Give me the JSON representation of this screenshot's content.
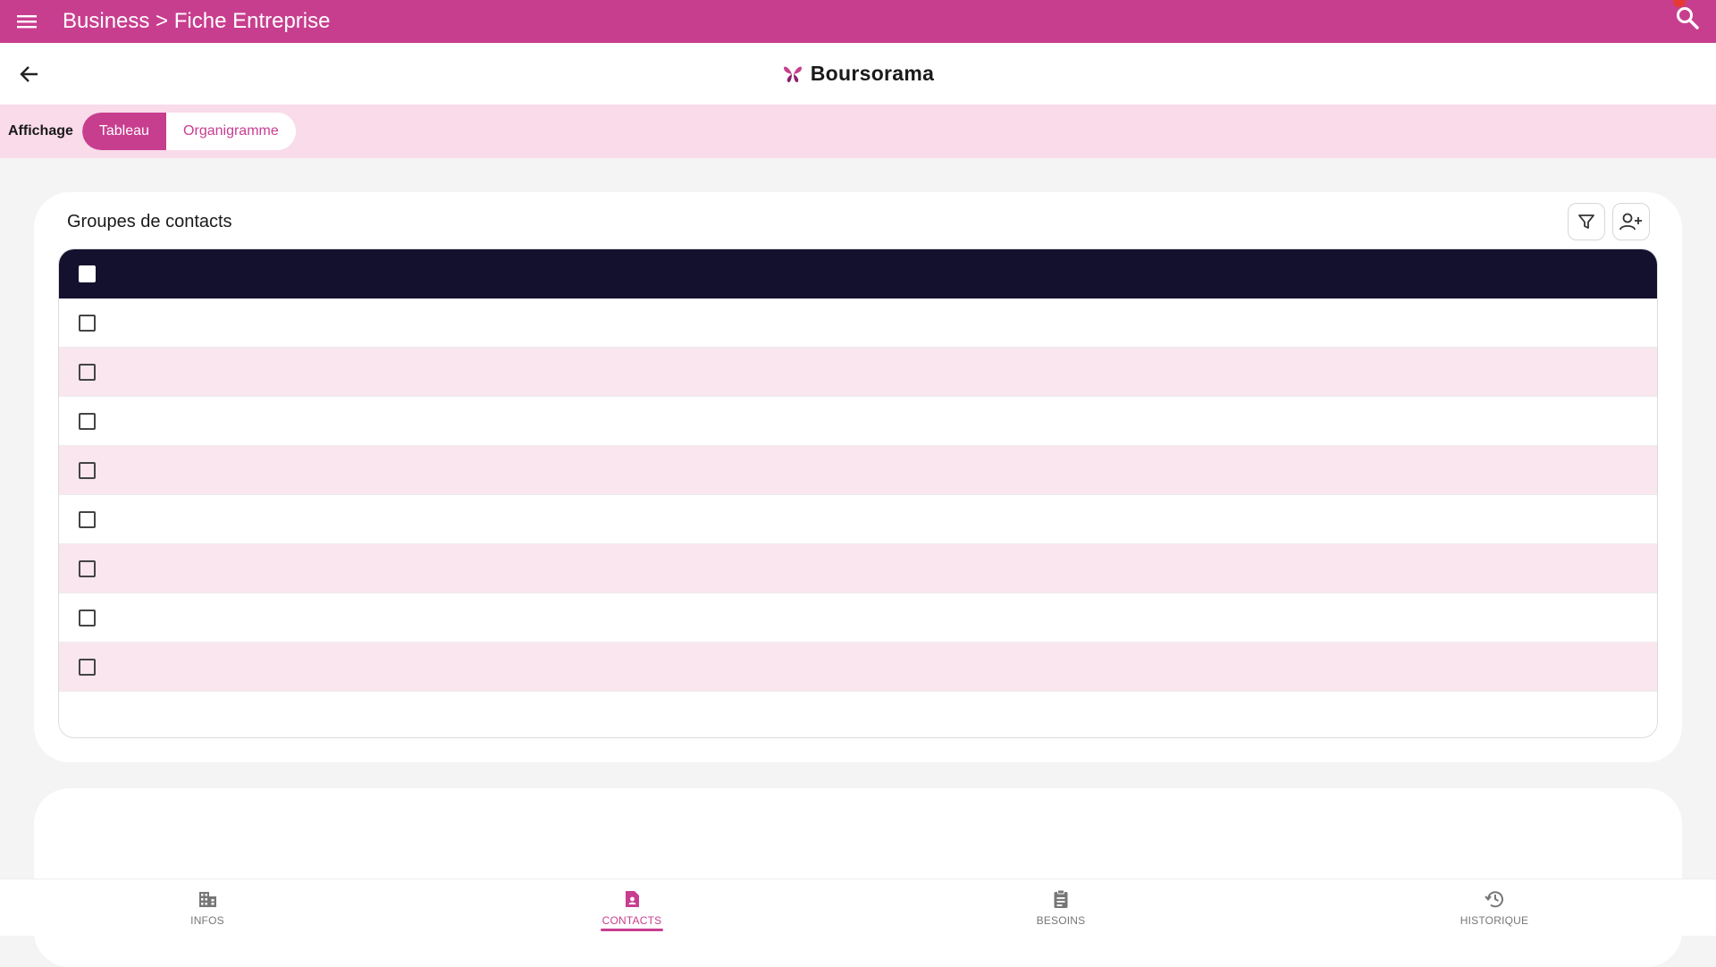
{
  "topbar": {
    "title": "Business > Fiche Entreprise",
    "color": "#c83e8f",
    "menu_icon": "menu-icon",
    "search_icon": "search-icon"
  },
  "header": {
    "company_name": "Boursorama",
    "back_icon": "arrow-left-icon",
    "logo_icon": "butterfly-logo"
  },
  "display": {
    "label": "Affichage",
    "options": [
      "Tableau",
      "Organigramme"
    ],
    "selected": "Tableau"
  },
  "contacts_card": {
    "title": "Groupes de contacts",
    "filter_icon": "filter-icon",
    "add_contact_icon": "add-contact-icon",
    "row_count": 8
  },
  "bottom_nav": {
    "items": [
      {
        "label": "INFOS",
        "icon": "building-icon",
        "active": false
      },
      {
        "label": "CONTACTS",
        "icon": "contact-file-icon",
        "active": true
      },
      {
        "label": "BESOINS",
        "icon": "clipboard-icon",
        "active": false
      },
      {
        "label": "HISTORIQUE",
        "icon": "history-icon",
        "active": false
      }
    ],
    "active_color": "#c83e8f"
  }
}
